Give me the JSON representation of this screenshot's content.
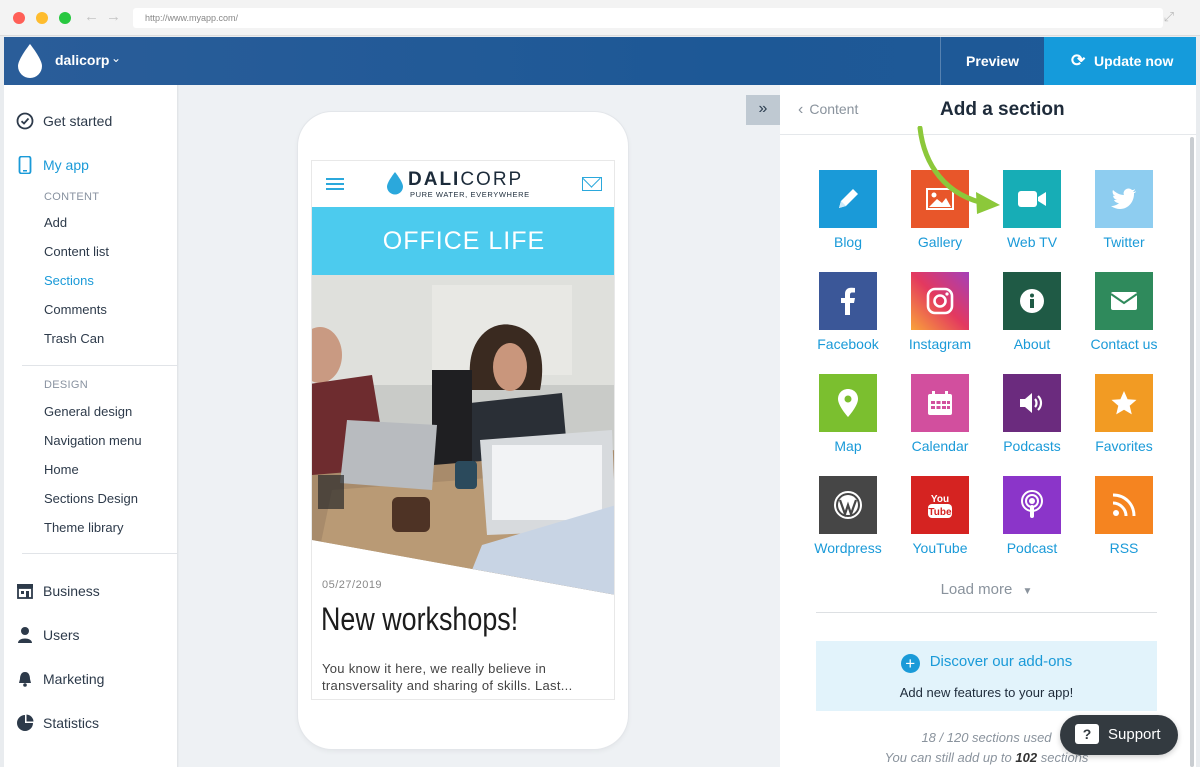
{
  "browser": {
    "url": "http://www.myapp.com/"
  },
  "header": {
    "brand": "dalicorp",
    "preview_label": "Preview",
    "update_label": "Update now"
  },
  "sidebar": {
    "get_started": "Get started",
    "my_app": "My app",
    "content_heading": "CONTENT",
    "content_items": [
      "Add",
      "Content list",
      "Sections",
      "Comments",
      "Trash Can"
    ],
    "design_heading": "DESIGN",
    "design_items": [
      "General design",
      "Navigation menu",
      "Home",
      "Sections Design",
      "Theme library"
    ],
    "business": "Business",
    "users": "Users",
    "marketing": "Marketing",
    "statistics": "Statistics",
    "active_item": "Sections"
  },
  "phone": {
    "logo_bold": "DALI",
    "logo_light": "CORP",
    "tagline": "PURE WATER, EVERYWHERE",
    "banner": "OFFICE LIFE",
    "post_date": "05/27/2019",
    "post_title": "New workshops!",
    "post_excerpt": "You know it here, we really believe in transversality and sharing of skills. Last..."
  },
  "panel": {
    "back_label": "Content",
    "title": "Add a section",
    "sections": [
      {
        "label": "Blog",
        "color": "#1a9ad8",
        "icon": "pencil-icon"
      },
      {
        "label": "Gallery",
        "color": "#e8562a",
        "icon": "image-icon"
      },
      {
        "label": "Web TV",
        "color": "#17adb6",
        "icon": "video-camera-icon"
      },
      {
        "label": "Twitter",
        "color": "#8ecdf0",
        "icon": "twitter-icon"
      },
      {
        "label": "Facebook",
        "color": "#3b5798",
        "icon": "facebook-icon"
      },
      {
        "label": "Instagram",
        "color": "#d6378f",
        "icon": "instagram-icon"
      },
      {
        "label": "About",
        "color": "#1f5a45",
        "icon": "info-icon"
      },
      {
        "label": "Contact us",
        "color": "#2f8a5c",
        "icon": "envelope-icon"
      },
      {
        "label": "Map",
        "color": "#7bbf2f",
        "icon": "map-pin-icon"
      },
      {
        "label": "Calendar",
        "color": "#d24f9e",
        "icon": "calendar-icon"
      },
      {
        "label": "Podcasts",
        "color": "#6b2b7e",
        "icon": "speaker-icon"
      },
      {
        "label": "Favorites",
        "color": "#f29b23",
        "icon": "star-icon"
      },
      {
        "label": "Wordpress",
        "color": "#464646",
        "icon": "wordpress-icon"
      },
      {
        "label": "YouTube",
        "color": "#d52321",
        "icon": "youtube-icon"
      },
      {
        "label": "Podcast",
        "color": "#8b35c9",
        "icon": "podcast-icon"
      },
      {
        "label": "RSS",
        "color": "#f58420",
        "icon": "rss-icon"
      }
    ],
    "load_more": "Load more",
    "addons_link": "Discover our add-ons",
    "addons_sub": "Add new features to your app!",
    "used": "18 / 120 sections used",
    "remaining_prefix": "You can still add up to",
    "remaining_count": "102",
    "remaining_suffix": "sections"
  },
  "support": {
    "label": "Support"
  }
}
